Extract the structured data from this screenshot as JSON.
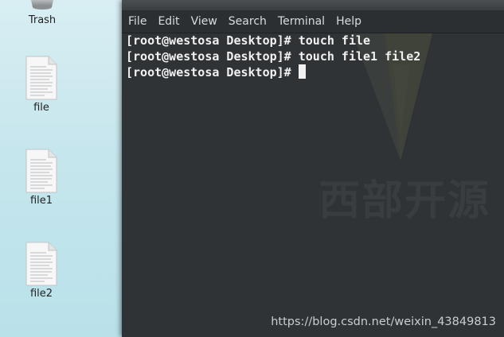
{
  "desktop": {
    "icons": [
      {
        "name": "trash",
        "label": "Trash"
      },
      {
        "name": "file",
        "label": "file"
      },
      {
        "name": "file1",
        "label": "file1"
      },
      {
        "name": "file2",
        "label": "file2"
      }
    ]
  },
  "terminal": {
    "menu": [
      "File",
      "Edit",
      "View",
      "Search",
      "Terminal",
      "Help"
    ],
    "lines": [
      {
        "prompt": "[root@westosa Desktop]#",
        "command": " touch file"
      },
      {
        "prompt": "[root@westosa Desktop]#",
        "command": " touch file1 file2"
      },
      {
        "prompt": "[root@westosa Desktop]#",
        "command": ""
      }
    ],
    "watermark_text": "西部开源"
  },
  "overlay": {
    "url": "https://blog.csdn.net/weixin_43849813"
  },
  "colors": {
    "terminal_bg": "#2f3336",
    "terminal_text": "#f1f1f1",
    "desktop_bg": "#c6e6ed"
  }
}
